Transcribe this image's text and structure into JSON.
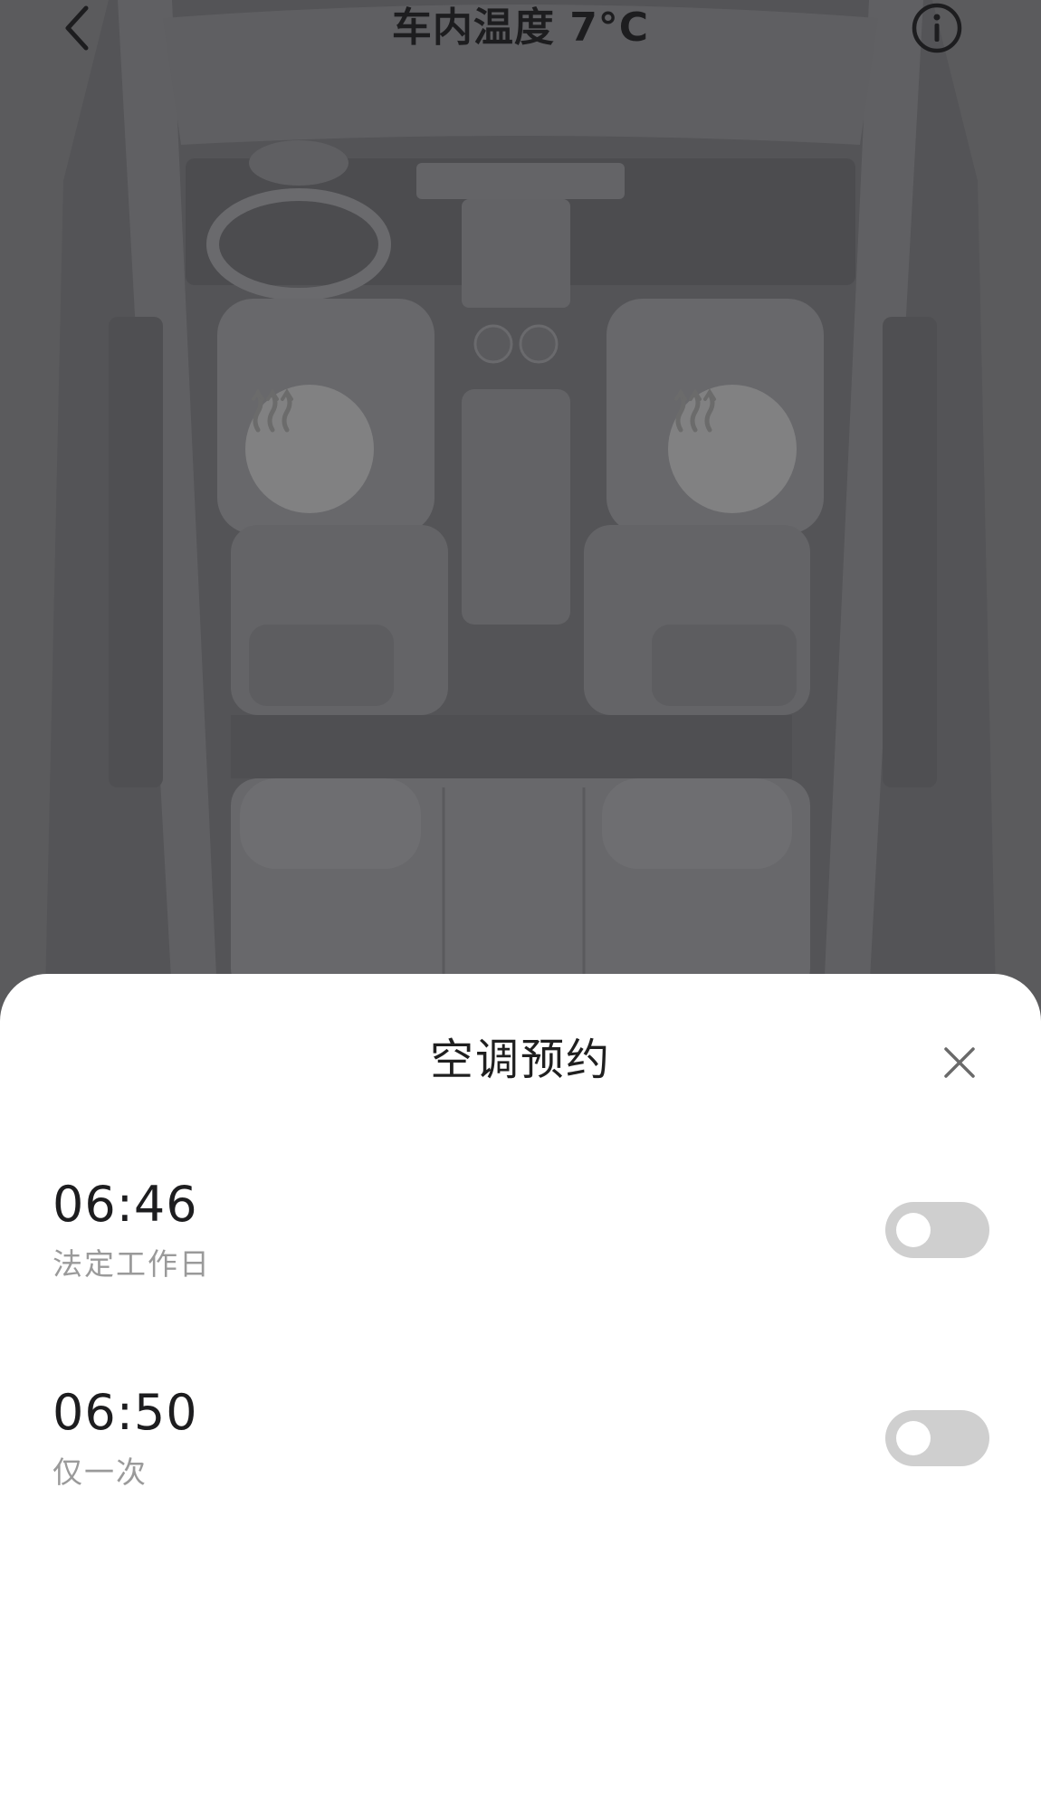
{
  "header": {
    "title": "车内温度 7°C",
    "back_icon": "chevron-left-icon",
    "info_icon": "info-circle-icon"
  },
  "car_view": {
    "seat_heat_left_icon": "seat-heat-icon",
    "seat_heat_right_icon": "seat-heat-icon"
  },
  "sheet": {
    "title": "空调预约",
    "close_icon": "close-icon",
    "schedules": [
      {
        "time": "06:46",
        "repeat": "法定工作日",
        "enabled": false
      },
      {
        "time": "06:50",
        "repeat": "仅一次",
        "enabled": false
      }
    ]
  },
  "colors": {
    "overlay": "#5b5b5d",
    "sheet_background": "#ffffff",
    "toggle_off": "#cfcfcf",
    "secondary_text": "#9a9a9a"
  }
}
